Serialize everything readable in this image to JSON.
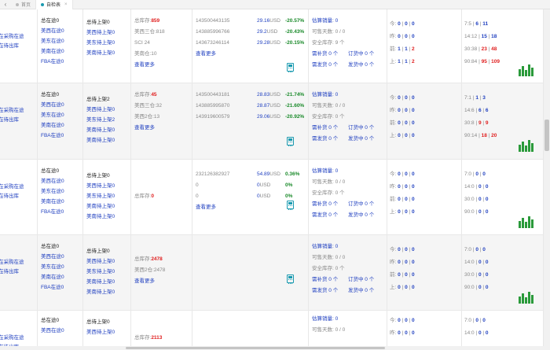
{
  "tabs": [
    {
      "label": "首页",
      "active": false
    },
    {
      "label": "自检表",
      "active": true
    }
  ],
  "rows": [
    {
      "col1": [
        "在采购在途",
        "在待出库"
      ],
      "col2": [
        "总在途0",
        "美西在途0",
        "美东在途0",
        "美南在途0",
        "FBA在途0"
      ],
      "col3": [
        "总待上架0",
        "美西待上架0",
        "美东待上架0",
        "美南待上架0"
      ],
      "total_stock": "859",
      "stock_lines": [
        "美西三仓:818",
        "SCI 24",
        "美南仓:10"
      ],
      "more": "查看更多",
      "skus": [
        [
          "143500443135",
          "29.16",
          "-20.57%"
        ],
        [
          "143885996766",
          "29.2",
          "-20.43%"
        ],
        [
          "143673246114",
          "29.28",
          "-20.15%"
        ]
      ],
      "more2": "查看更多",
      "est_sales": "0",
      "sellable_days": "0 / 0",
      "safety_stock": "9",
      "restock": "0",
      "ordered": "0",
      "shipping": "0",
      "shipped": "0",
      "sales_days": [
        [
          "今",
          "0",
          "0",
          "0"
        ],
        [
          "昨",
          "0",
          "0",
          "0"
        ],
        [
          "前",
          "1",
          "1",
          "2"
        ],
        [
          "上",
          "1",
          "1",
          "2"
        ]
      ],
      "trend": [
        [
          "7:5",
          "6",
          "11"
        ],
        [
          "14:12",
          "15",
          "18"
        ],
        [
          "30:38",
          "23",
          "48"
        ],
        [
          "90:84",
          "95",
          "109"
        ]
      ]
    },
    {
      "col1": [
        "在采购在途",
        "在待出库"
      ],
      "col2": [
        "总在途0",
        "美西在途0",
        "美东在途0",
        "美南在途0",
        "FBA在途0"
      ],
      "col3": [
        "总待上架2",
        "美西待上架0",
        "美东待上架2",
        "美南待上架0",
        "美南待上架0"
      ],
      "total_stock": "45",
      "stock_lines": [
        "美西三仓:32",
        "美西2仓:13"
      ],
      "more": "查看更多",
      "skus": [
        [
          "143500443181",
          "28.83",
          "-21.74%"
        ],
        [
          "143885995870",
          "28.87",
          "-21.60%"
        ],
        [
          "143919600579",
          "29.06",
          "-20.92%"
        ]
      ],
      "more2": "",
      "est_sales": "0",
      "sellable_days": "0 / 0",
      "safety_stock": "0",
      "restock": "0",
      "ordered": "0",
      "shipping": "0",
      "shipped": "0",
      "sales_days": [
        [
          "今",
          "0",
          "0",
          "0"
        ],
        [
          "昨",
          "0",
          "0",
          "0"
        ],
        [
          "前",
          "0",
          "0",
          "0"
        ],
        [
          "上",
          "0",
          "0",
          "0"
        ]
      ],
      "trend": [
        [
          "7:1",
          "1",
          "3"
        ],
        [
          "14:6",
          "6",
          "6"
        ],
        [
          "30:8",
          "9",
          "9"
        ],
        [
          "90:14",
          "18",
          "20"
        ]
      ]
    },
    {
      "col1": [
        "在采购在途",
        "在待出库"
      ],
      "col2": [
        "总在途0",
        "美西在途0",
        "美东在途0",
        "美南在途0",
        "FBA在途0"
      ],
      "col3": [
        "总待上架0",
        "美西待上架0",
        "美东待上架0",
        "美南待上架0",
        "美南待上架0"
      ],
      "total_stock": "0",
      "stock_lines": [],
      "more": "",
      "skus": [
        [
          "232126382927",
          "54.89",
          "0.36%"
        ],
        [
          "0",
          "0",
          "0%"
        ],
        [
          "0",
          "0",
          "0%"
        ]
      ],
      "more2": "查看更多",
      "est_sales": "0",
      "sellable_days": "0 / 0",
      "safety_stock": "0",
      "restock": "0",
      "ordered": "0",
      "shipping": "0",
      "shipped": "0",
      "sales_days": [
        [
          "今",
          "0",
          "0",
          "0"
        ],
        [
          "昨",
          "0",
          "0",
          "0"
        ],
        [
          "前",
          "0",
          "0",
          "0"
        ],
        [
          "上",
          "0",
          "0",
          "0"
        ]
      ],
      "trend": [
        [
          "7:0",
          "0",
          "0"
        ],
        [
          "14:0",
          "0",
          "0"
        ],
        [
          "30:0",
          "0",
          "0"
        ],
        [
          "90:0",
          "0",
          "0"
        ]
      ]
    },
    {
      "col1": [
        "在采购在途",
        "在待出库"
      ],
      "col2": [
        "总在途0",
        "美西在途0",
        "美东在途0",
        "美南在途0",
        "FBA在途0"
      ],
      "col3": [
        "总待上架0",
        "美西待上架0",
        "美东待上架0",
        "美南待上架0",
        "美南待上架0"
      ],
      "total_stock": "2478",
      "stock_lines": [
        "美西2仓:2478"
      ],
      "more": "查看更多",
      "skus": [],
      "more2": "",
      "est_sales": "0",
      "sellable_days": "0 / 0",
      "safety_stock": "0",
      "restock": "0",
      "ordered": "0",
      "shipping": "0",
      "shipped": "0",
      "sales_days": [
        [
          "今",
          "0",
          "0",
          "0"
        ],
        [
          "昨",
          "0",
          "0",
          "0"
        ],
        [
          "前",
          "0",
          "0",
          "0"
        ],
        [
          "上",
          "0",
          "0",
          "0"
        ]
      ],
      "trend": [
        [
          "7:0",
          "0",
          "0"
        ],
        [
          "14:0",
          "0",
          "0"
        ],
        [
          "30:0",
          "0",
          "0"
        ],
        [
          "90:0",
          "0",
          "0"
        ]
      ]
    },
    {
      "col1": [
        "在采购在途",
        "在待出库"
      ],
      "col2": [
        "总在途0",
        "美西在途0"
      ],
      "col3": [
        "总待上架0",
        "美西待上架0"
      ],
      "total_stock": "2113",
      "stock_lines": [],
      "more": "",
      "skus": [],
      "more2": "",
      "est_sales": "0",
      "sellable_days": "0 / 0",
      "safety_stock": "",
      "restock": "",
      "ordered": "",
      "shipping": "",
      "shipped": "",
      "sales_days": [
        [
          "今",
          "0",
          "0",
          "0"
        ],
        [
          "昨",
          "0",
          "0",
          "0"
        ]
      ],
      "trend": [
        [
          "7:0",
          "0",
          "0"
        ],
        [
          "14:0",
          "0",
          "0"
        ]
      ]
    }
  ],
  "labels": {
    "total_stock": "总库存:",
    "est_sales": "估算销量:",
    "sellable_days": "可售天数:",
    "safety_stock": "安全库存:",
    "safety_unit": "个",
    "restock": "需补货",
    "ordered": "订货中",
    "shipping": "需发货",
    "shipped": "发货中",
    "unit": "个",
    "currency": "USD"
  },
  "colors": {
    "accent": "#1a9ab0",
    "link": "#2040c0",
    "alert": "#e02020",
    "positive": "#1a8a2a",
    "chart_green": "#2a9a3a"
  }
}
